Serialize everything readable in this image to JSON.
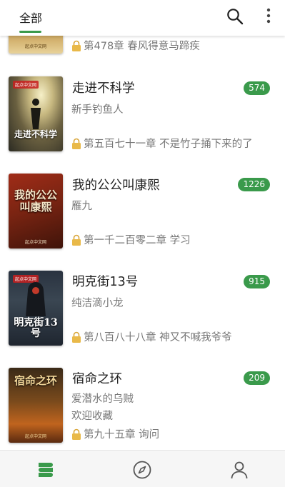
{
  "header": {
    "tab_all": "全部"
  },
  "books": [
    {
      "title": "",
      "author": "",
      "extra": "",
      "chapter": "第478章 春风得意马蹄疾",
      "count": "",
      "cover_text": "",
      "cover_badge": "起点中文网"
    },
    {
      "title": "走进不科学",
      "author": "新手钓鱼人",
      "extra": "",
      "chapter": "第五百七十一章 不是竹子捅下来的了",
      "count": "574",
      "cover_text": "走进不科学",
      "cover_badge": "起点中文网"
    },
    {
      "title": "我的公公叫康熙",
      "author": "雁九",
      "extra": "",
      "chapter": "第一千二百零二章 学习",
      "count": "1226",
      "cover_text": "我的公公叫康熙",
      "cover_badge": "起点中文网"
    },
    {
      "title": "明克街13号",
      "author": "纯洁滴小龙",
      "extra": "",
      "chapter": "第八百八十八章 神又不喊我爷爷",
      "count": "915",
      "cover_text": "明克街13号",
      "cover_badge": "起点中文网"
    },
    {
      "title": "宿命之环",
      "author": "爱潜水的乌贼",
      "extra": "欢迎收藏",
      "chapter": "第九十五章 询问",
      "count": "209",
      "cover_text": "宿命之环",
      "cover_badge": "起点中文网"
    }
  ],
  "nav": [
    {
      "icon": "bookshelf-icon",
      "active": true
    },
    {
      "icon": "compass-icon",
      "active": false
    },
    {
      "icon": "profile-icon",
      "active": false
    }
  ],
  "colors": {
    "accent": "#3a9a4b",
    "muted": "#777777"
  }
}
